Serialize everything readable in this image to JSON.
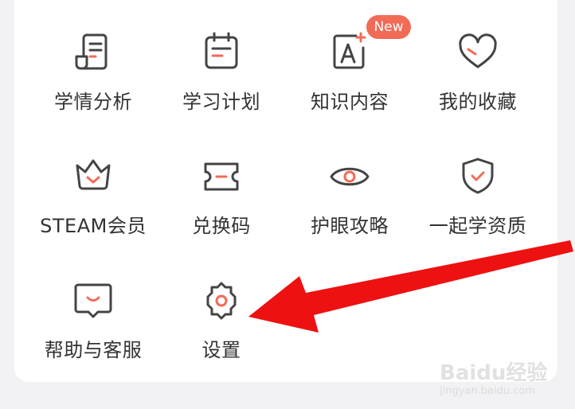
{
  "menu": {
    "items": [
      {
        "label": "学情分析",
        "icon": "report-icon"
      },
      {
        "label": "学习计划",
        "icon": "calendar-icon"
      },
      {
        "label": "知识内容",
        "icon": "knowledge-icon"
      },
      {
        "label": "我的收藏",
        "icon": "heart-icon"
      },
      {
        "label": "STEAM会员",
        "icon": "crown-icon"
      },
      {
        "label": "兑换码",
        "icon": "ticket-icon"
      },
      {
        "label": "护眼攻略",
        "icon": "eye-icon"
      },
      {
        "label": "一起学资质",
        "icon": "shield-icon"
      },
      {
        "label": "帮助与客服",
        "icon": "chat-icon"
      },
      {
        "label": "设置",
        "icon": "gear-icon"
      }
    ],
    "new_badge": "New"
  },
  "watermark": {
    "logo": "Baidu经验",
    "url": "jingyan.baidu.com"
  },
  "colors": {
    "accent": "#f26b57",
    "icon_stroke": "#444444",
    "annotation_arrow": "#ee1111"
  }
}
